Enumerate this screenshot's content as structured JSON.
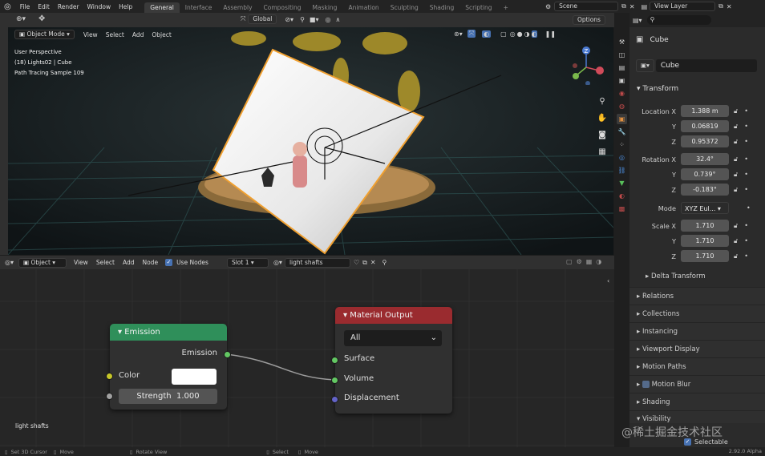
{
  "topbar": {
    "menus": [
      "File",
      "Edit",
      "Render",
      "Window",
      "Help"
    ],
    "workspaces": [
      "General",
      "Interface",
      "Assembly",
      "Compositing",
      "Masking",
      "Animation",
      "Sculpting",
      "Shading",
      "Scripting"
    ],
    "active_workspace": "General",
    "scene": "Scene",
    "view_layer": "View Layer"
  },
  "viewport_header": {
    "mode": "Object Mode",
    "menus": [
      "View",
      "Select",
      "Add",
      "Object"
    ],
    "orientation": "Global",
    "options": "Options"
  },
  "viewport": {
    "info_lines": [
      "User Perspective",
      "(18) Lights02 | Cube",
      "Path Tracing Sample 109"
    ]
  },
  "node_header": {
    "type": "Object",
    "menus": [
      "View",
      "Select",
      "Add",
      "Node"
    ],
    "use_nodes": "Use Nodes",
    "slot": "Slot 1",
    "material": "light shafts"
  },
  "node_editor": {
    "label": "light shafts",
    "emission_node": {
      "title": "Emission",
      "output": "Emission",
      "color_label": "Color",
      "strength_label": "Strength",
      "strength_value": "1.000",
      "color_hex": "#ffffff"
    },
    "output_node": {
      "title": "Material Output",
      "target": "All",
      "inputs": [
        "Surface",
        "Volume",
        "Displacement"
      ]
    }
  },
  "properties": {
    "object_name": "Cube",
    "data_name": "Cube",
    "transform_title": "Transform",
    "location": {
      "label": "Location",
      "x": "1.388 m",
      "y": "0.06819",
      "z": "0.95372"
    },
    "rotation": {
      "label": "Rotation",
      "x": "32.4°",
      "y": "0.739°",
      "z": "-0.183°"
    },
    "mode_label": "Mode",
    "mode_value": "XYZ Eul...",
    "scale": {
      "label": "Scale",
      "x": "1.710",
      "y": "1.710",
      "z": "1.710"
    },
    "axis": {
      "x": "X",
      "y": "Y",
      "z": "Z"
    },
    "delta_transform": "Delta Transform",
    "panels": [
      "Relations",
      "Collections",
      "Instancing",
      "Viewport Display",
      "Motion Paths",
      "Motion Blur",
      "Shading",
      "Visibility"
    ],
    "selectable": "Selectable"
  },
  "status": {
    "left": [
      "Set 3D Cursor",
      "Move",
      "Rotate View"
    ],
    "mid": [
      "Select",
      "Move"
    ],
    "version": "2.92.0 Alpha"
  },
  "watermark": "@稀土掘金技术社区",
  "colors": {
    "emission_header": "#2f8f5a",
    "output_header": "#9a2b2f",
    "socket_green": "#63c763",
    "socket_yellow": "#c7c729",
    "socket_gray": "#a1a1a1",
    "socket_purple": "#6363c7",
    "accent_blue": "#4772b3"
  }
}
